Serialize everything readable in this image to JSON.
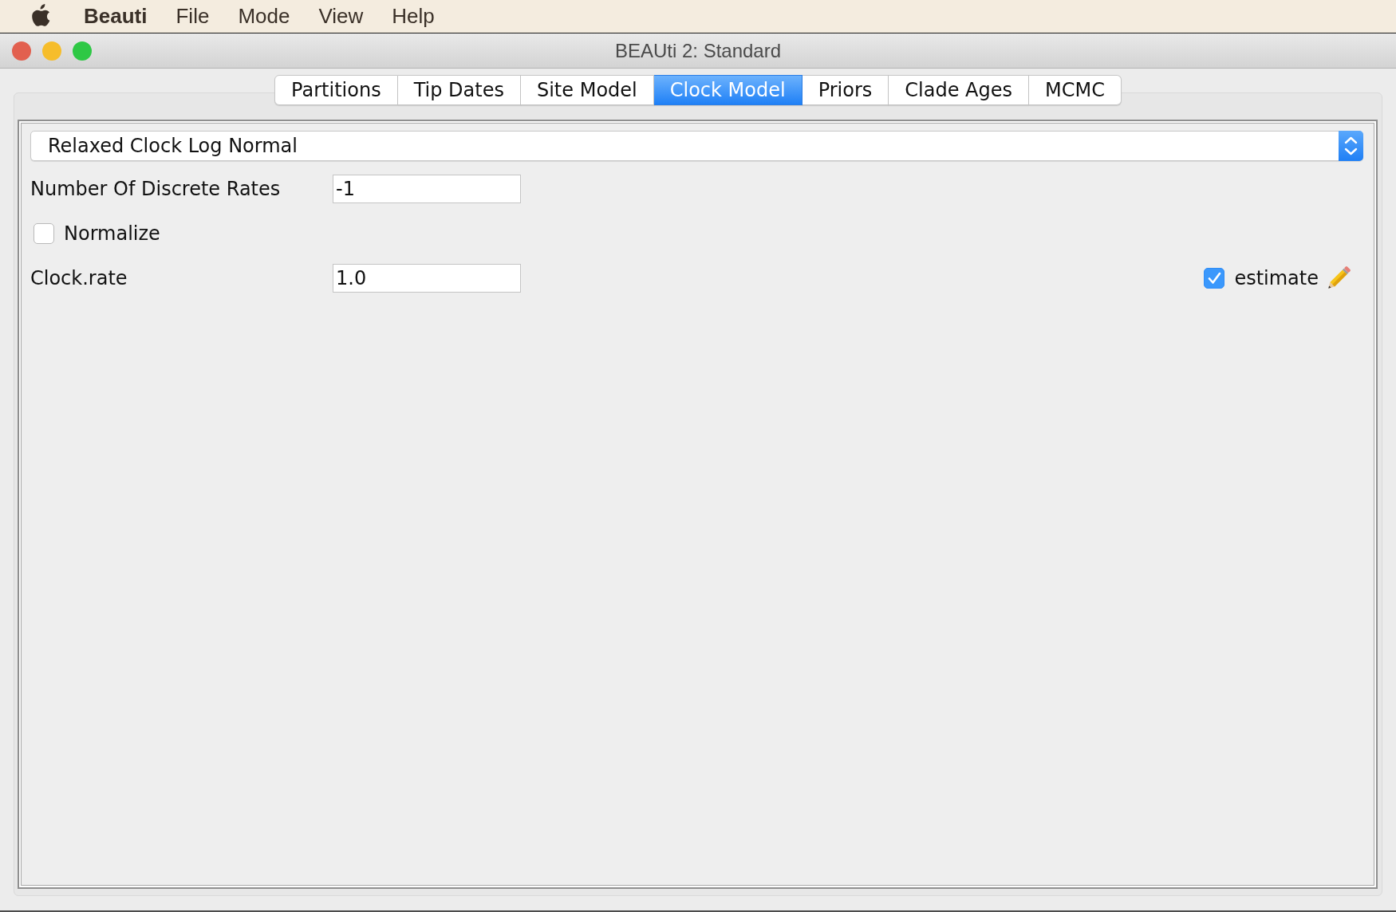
{
  "menu_bar": {
    "app_name": "Beauti",
    "items": [
      "File",
      "Mode",
      "View",
      "Help"
    ]
  },
  "window": {
    "title": "BEAUti 2: Standard"
  },
  "tabs": [
    {
      "label": "Partitions",
      "selected": false
    },
    {
      "label": "Tip Dates",
      "selected": false
    },
    {
      "label": "Site Model",
      "selected": false
    },
    {
      "label": "Clock Model",
      "selected": true
    },
    {
      "label": "Priors",
      "selected": false
    },
    {
      "label": "Clade Ages",
      "selected": false
    },
    {
      "label": "MCMC",
      "selected": false
    }
  ],
  "clock_model": {
    "model": "Relaxed Clock Log Normal",
    "rows": [
      {
        "kind": "field",
        "label": "Number Of Discrete Rates",
        "value": "-1"
      },
      {
        "kind": "checkbox",
        "label": "Normalize",
        "checked": false
      },
      {
        "kind": "field",
        "label": "Clock.rate",
        "value": "1.0",
        "estimate": {
          "label": "estimate",
          "checked": true
        }
      }
    ]
  }
}
